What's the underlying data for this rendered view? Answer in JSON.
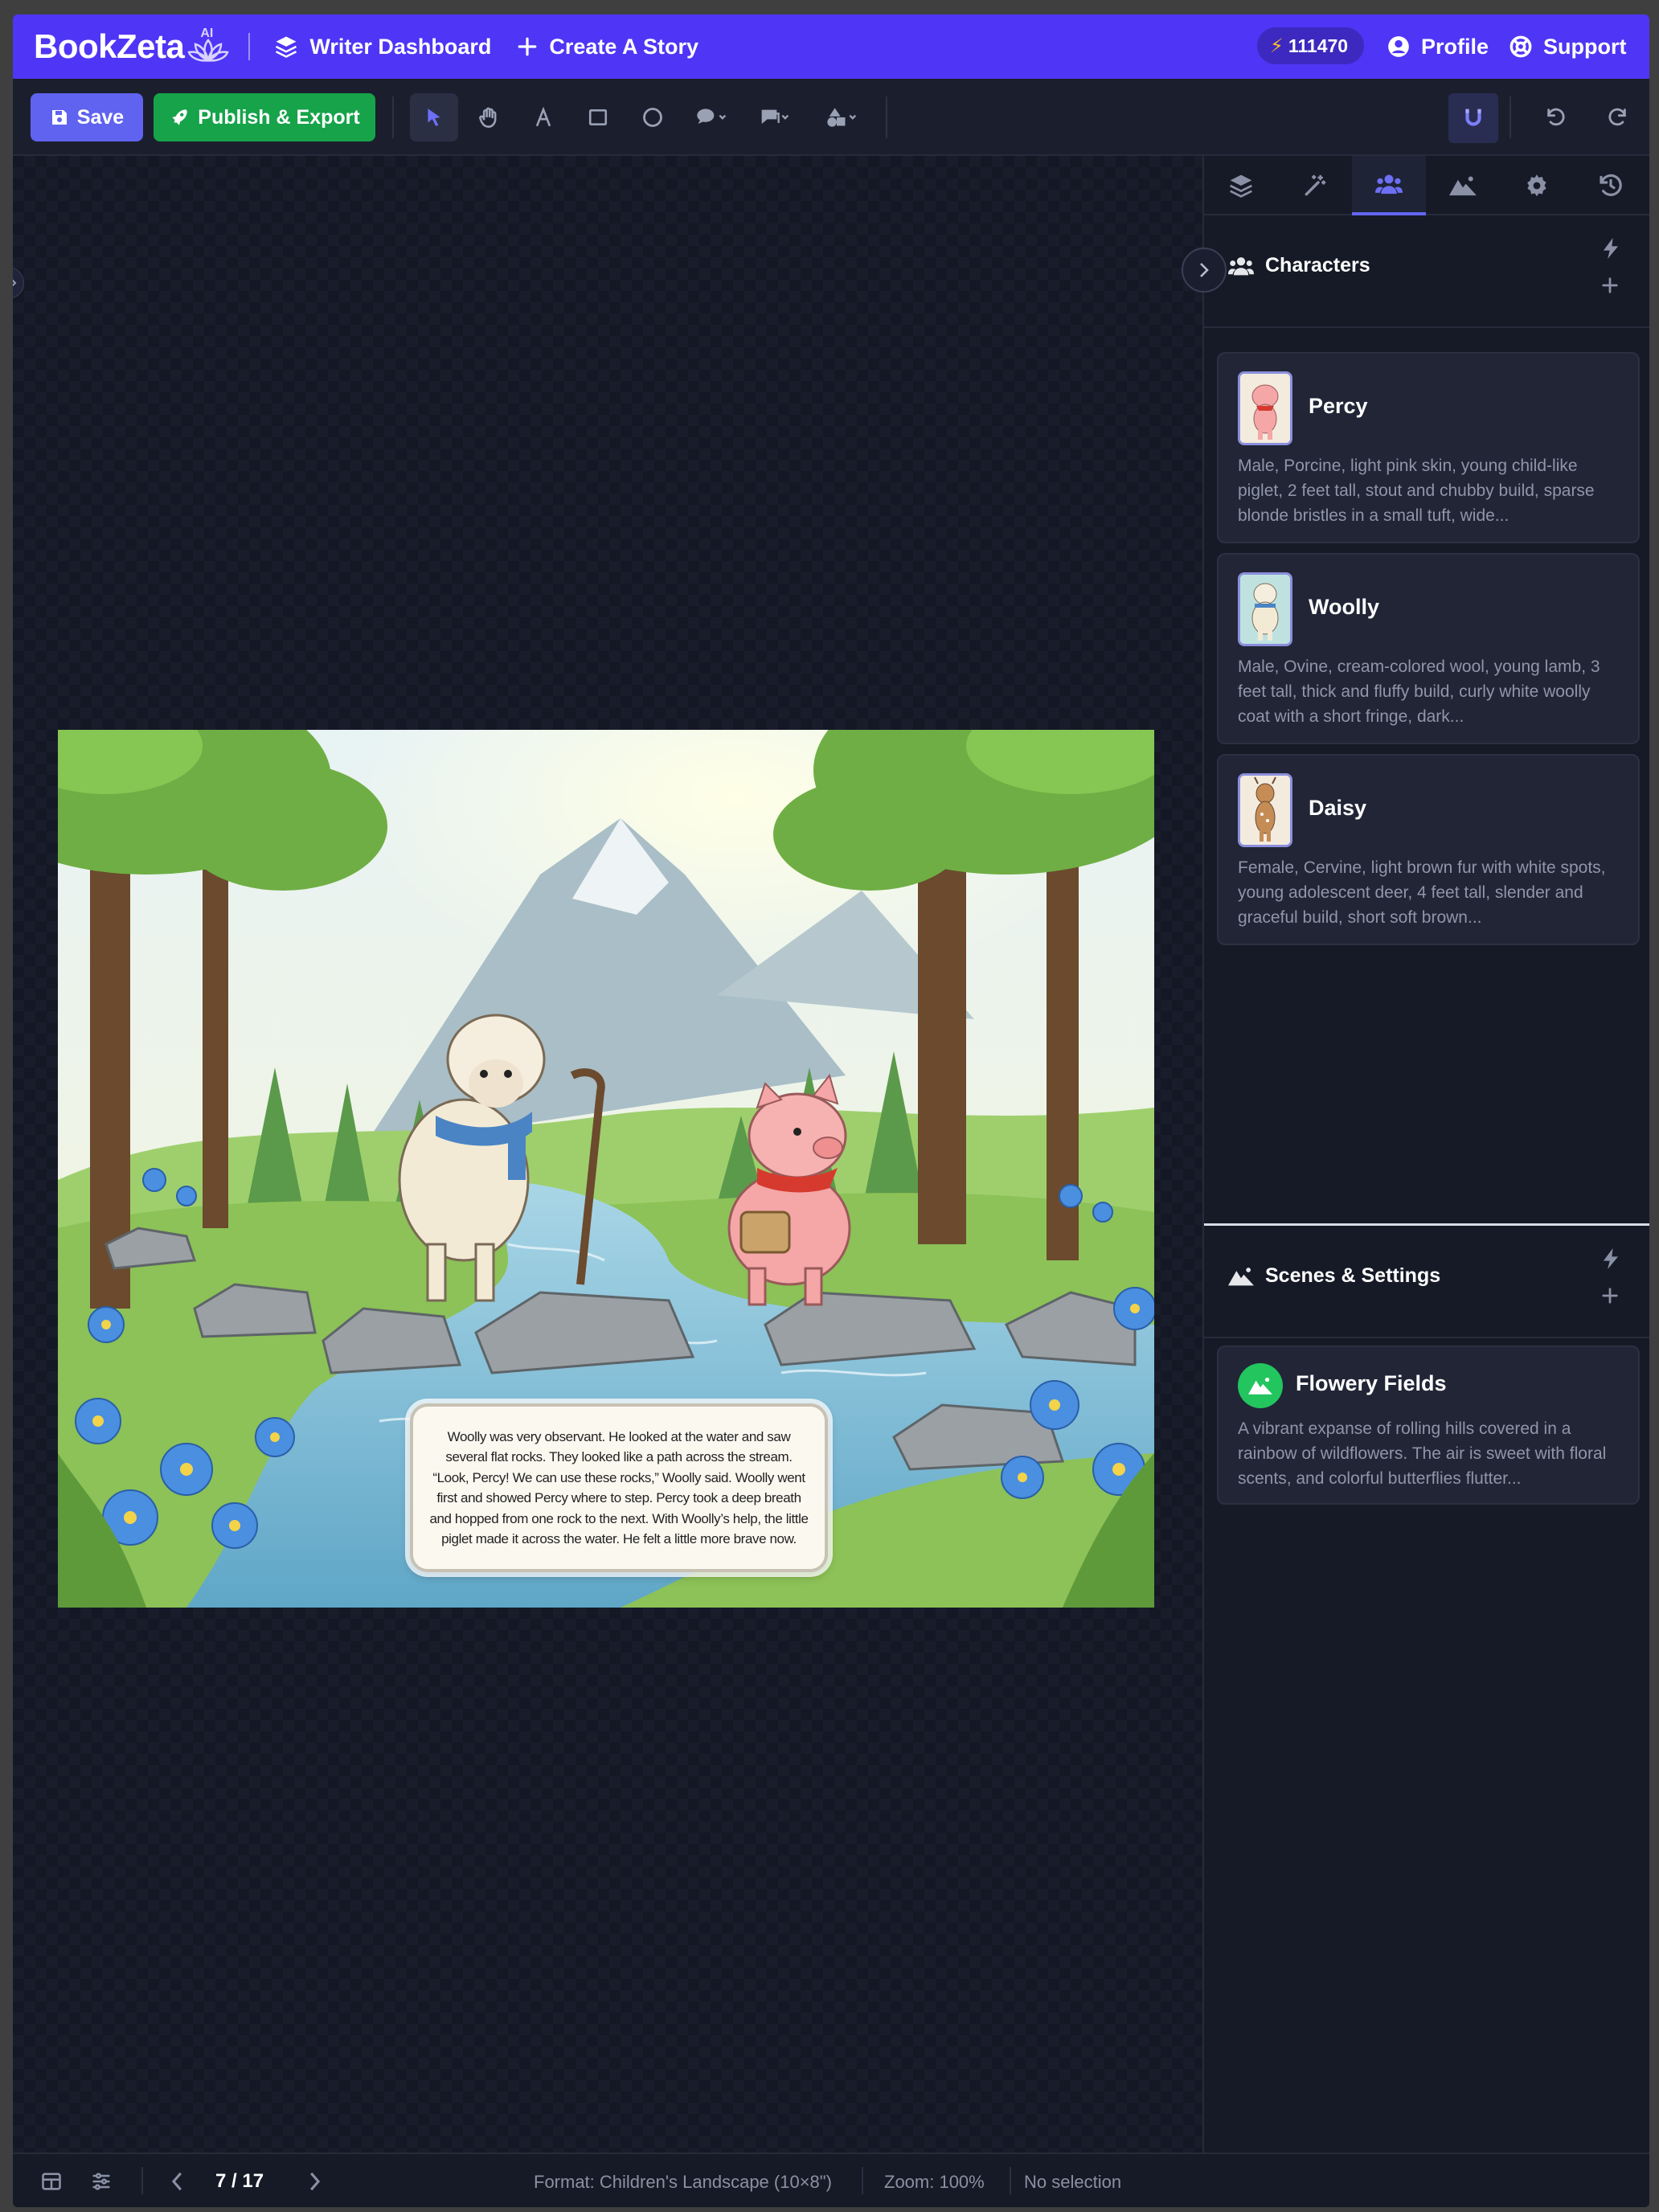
{
  "app": {
    "logo_text": "BookZeta",
    "logo_badge": "AI",
    "accent": "#4f35f5"
  },
  "nav": {
    "writer_dashboard": "Writer Dashboard",
    "create_story": "Create A Story",
    "credits": "111470",
    "profile": "Profile",
    "support": "Support"
  },
  "toolbar": {
    "save": "Save",
    "publish": "Publish & Export",
    "tools": [
      "select-pointer-icon",
      "hand-pan-icon",
      "text-tool-icon",
      "rectangle-icon",
      "circle-icon",
      "speech-bubble-icon",
      "callout-icon",
      "shapes-icon"
    ],
    "magnet": "snap-magnet-icon",
    "undo": "undo-icon",
    "redo": "redo-icon"
  },
  "page": {
    "story_text": "Woolly was very observant. He looked at the water and saw several flat rocks. They looked like a path across the stream. “Look, Percy! We can use these rocks,” Woolly said. Woolly went first and showed Percy where to step. Percy took a deep breath and hopped from one rock to the next. With Woolly’s help, the little piglet made it across the water. He felt a little more brave now."
  },
  "panel": {
    "tabs": [
      "layers-icon",
      "magic-wand-icon",
      "characters-icon",
      "scenes-icon",
      "settings-icon",
      "history-icon"
    ],
    "active_tab": "characters-icon",
    "characters_title": "Characters",
    "characters": [
      {
        "name": "Percy",
        "description": "Male, Porcine, light pink skin, young child-like piglet, 2 feet tall, stout and chubby build, sparse blonde bristles in a small tuft, wide..."
      },
      {
        "name": "Woolly",
        "description": "Male, Ovine, cream-colored wool, young lamb, 3 feet tall, thick and fluffy build, curly white woolly coat with a short fringe, dark..."
      },
      {
        "name": "Daisy",
        "description": "Female, Cervine, light brown fur with white spots, young adolescent deer, 4 feet tall, slender and graceful build, short soft brown..."
      }
    ],
    "scenes_title": "Scenes & Settings",
    "scenes": [
      {
        "name": "Flowery Fields",
        "description": "A vibrant expanse of rolling hills covered in a rainbow of wildflowers. The air is sweet with floral scents, and colorful butterflies flutter..."
      }
    ]
  },
  "status": {
    "page": "7 / 17",
    "format": "Format: Children's Landscape (10×8\")",
    "zoom": "Zoom: 100%",
    "selection": "No selection"
  }
}
